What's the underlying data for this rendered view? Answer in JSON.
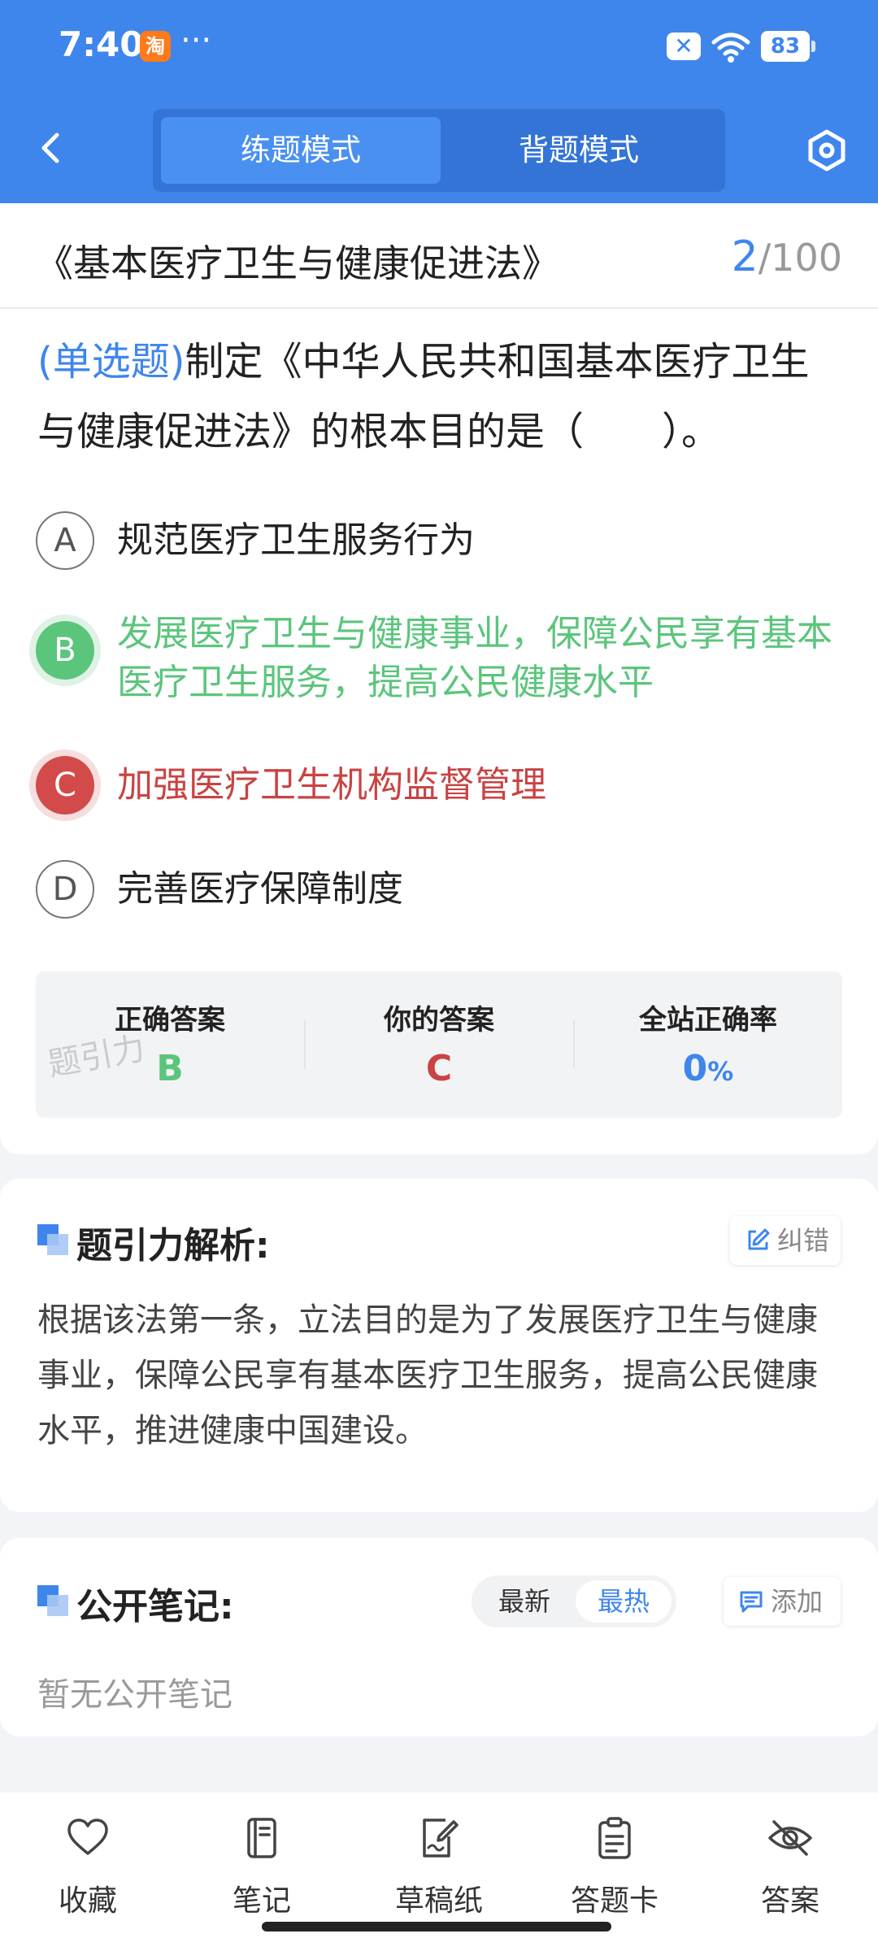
{
  "status_bar": {
    "time": "7:40",
    "app_icon_char": "淘",
    "more": "···",
    "battery": "83"
  },
  "header": {
    "tabs": [
      "练题模式",
      "背题模式"
    ],
    "active_tab": 0,
    "colors": {
      "primary": "#3f86ec"
    }
  },
  "title_bar": {
    "title": "《基本医疗卫生与健康促进法》",
    "current": "2",
    "total": "/100"
  },
  "question": {
    "type": "(单选题)",
    "text": "制定《中华人民共和国基本医疗卫生与健康促进法》的根本目的是（　　）。",
    "options": [
      {
        "key": "A",
        "text": "规范医疗卫生服务行为",
        "state": "normal"
      },
      {
        "key": "B",
        "text": "发展医疗卫生与健康事业，保障公民享有基本医疗卫生服务，提高公民健康水平",
        "state": "correct"
      },
      {
        "key": "C",
        "text": "加强医疗卫生机构监督管理",
        "state": "wrong"
      },
      {
        "key": "D",
        "text": "完善医疗保障制度",
        "state": "normal"
      }
    ]
  },
  "stats": {
    "correct_label": "正确答案",
    "correct_value": "B",
    "yours_label": "你的答案",
    "yours_value": "C",
    "rate_label": "全站正确率",
    "rate_value": "0",
    "rate_unit": "%",
    "watermark": "题引力"
  },
  "analysis": {
    "title": "题引力解析:",
    "correct_button": "纠错",
    "text": "根据该法第一条，立法目的是为了发展医疗卫生与健康事业，保障公民享有基本医疗卫生服务，提高公民健康水平，推进健康中国建设。"
  },
  "notes": {
    "title": "公开笔记:",
    "sort_latest": "最新",
    "sort_hot": "最热",
    "add_button": "添加",
    "empty_text": "暂无公开笔记"
  },
  "bottom_nav": {
    "items": [
      {
        "label": "收藏",
        "icon": "heart-icon"
      },
      {
        "label": "笔记",
        "icon": "notebook-icon"
      },
      {
        "label": "草稿纸",
        "icon": "draft-icon"
      },
      {
        "label": "答题卡",
        "icon": "clipboard-icon"
      },
      {
        "label": "答案",
        "icon": "eye-off-icon"
      }
    ]
  }
}
